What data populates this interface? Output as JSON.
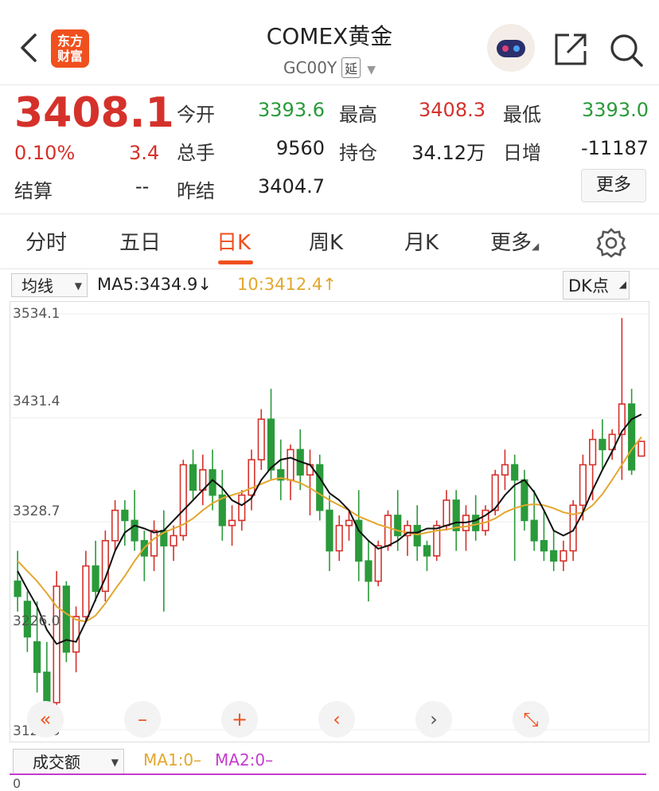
{
  "header": {
    "title": "COMEX黄金",
    "code": "GC00Y",
    "delay_badge": "延",
    "logo_line1": "东方",
    "logo_line2": "财富"
  },
  "quote": {
    "price": "3408.1",
    "change_pct": "0.10%",
    "change": "3.4",
    "settle_label": "结算",
    "settle_value": "--",
    "open_label": "今开",
    "open_value": "3393.6",
    "high_label": "最高",
    "high_value": "3408.3",
    "low_label": "最低",
    "low_value": "3393.0",
    "volume_label": "总手",
    "volume_value": "9560",
    "oi_label": "持仓",
    "oi_value": "34.12万",
    "daily_inc_label": "日增",
    "daily_inc_value": "-11187",
    "prev_settle_label": "昨结",
    "prev_settle_value": "3404.7",
    "more_button": "更多"
  },
  "tabs": [
    "分时",
    "五日",
    "日K",
    "周K",
    "月K",
    "更多"
  ],
  "toolbar": {
    "ma_select": "均线",
    "ma5": "MA5:3434.9",
    "ma10": "10:3412.4",
    "dk": "DK点"
  },
  "chart_data": {
    "type": "candlestick",
    "y_ticks": [
      "3534.1",
      "3431.4",
      "3328.7",
      "3226.0",
      "3123.3"
    ],
    "ylim": [
      3123.3,
      3534.1
    ],
    "up_color": "#d5312b",
    "down_color": "#2a9a3a",
    "ma5_color": "#111111",
    "ma10_color": "#e2a72e",
    "candles": [
      [
        3270,
        3300,
        3240,
        3255
      ],
      [
        3250,
        3260,
        3200,
        3215
      ],
      [
        3210,
        3250,
        3160,
        3180
      ],
      [
        3180,
        3210,
        3140,
        3150
      ],
      [
        3150,
        3280,
        3130,
        3265
      ],
      [
        3265,
        3270,
        3190,
        3200
      ],
      [
        3200,
        3245,
        3180,
        3235
      ],
      [
        3235,
        3300,
        3230,
        3285
      ],
      [
        3285,
        3310,
        3250,
        3260
      ],
      [
        3260,
        3320,
        3250,
        3310
      ],
      [
        3310,
        3350,
        3300,
        3340
      ],
      [
        3340,
        3350,
        3305,
        3330
      ],
      [
        3330,
        3360,
        3300,
        3310
      ],
      [
        3310,
        3320,
        3270,
        3295
      ],
      [
        3295,
        3330,
        3280,
        3320
      ],
      [
        3320,
        3340,
        3240,
        3305
      ],
      [
        3305,
        3325,
        3290,
        3315
      ],
      [
        3315,
        3390,
        3310,
        3385
      ],
      [
        3385,
        3400,
        3350,
        3360
      ],
      [
        3360,
        3395,
        3345,
        3380
      ],
      [
        3380,
        3400,
        3340,
        3355
      ],
      [
        3355,
        3380,
        3310,
        3325
      ],
      [
        3325,
        3345,
        3305,
        3330
      ],
      [
        3330,
        3360,
        3320,
        3355
      ],
      [
        3355,
        3400,
        3340,
        3390
      ],
      [
        3390,
        3440,
        3380,
        3430
      ],
      [
        3430,
        3460,
        3370,
        3380
      ],
      [
        3380,
        3410,
        3350,
        3370
      ],
      [
        3370,
        3405,
        3350,
        3400
      ],
      [
        3400,
        3420,
        3360,
        3375
      ],
      [
        3375,
        3400,
        3335,
        3385
      ],
      [
        3385,
        3395,
        3330,
        3340
      ],
      [
        3340,
        3355,
        3280,
        3300
      ],
      [
        3300,
        3335,
        3290,
        3325
      ],
      [
        3325,
        3340,
        3310,
        3330
      ],
      [
        3330,
        3360,
        3270,
        3290
      ],
      [
        3290,
        3310,
        3250,
        3270
      ],
      [
        3270,
        3310,
        3265,
        3305
      ],
      [
        3305,
        3340,
        3300,
        3335
      ],
      [
        3335,
        3360,
        3300,
        3315
      ],
      [
        3315,
        3330,
        3295,
        3325
      ],
      [
        3325,
        3345,
        3290,
        3305
      ],
      [
        3305,
        3310,
        3280,
        3295
      ],
      [
        3295,
        3330,
        3290,
        3325
      ],
      [
        3325,
        3360,
        3320,
        3350
      ],
      [
        3350,
        3360,
        3300,
        3320
      ],
      [
        3320,
        3345,
        3300,
        3335
      ],
      [
        3335,
        3355,
        3310,
        3320
      ],
      [
        3320,
        3345,
        3315,
        3340
      ],
      [
        3340,
        3380,
        3335,
        3375
      ],
      [
        3375,
        3400,
        3360,
        3385
      ],
      [
        3385,
        3395,
        3290,
        3370
      ],
      [
        3370,
        3380,
        3320,
        3330
      ],
      [
        3330,
        3360,
        3300,
        3310
      ],
      [
        3310,
        3340,
        3290,
        3300
      ],
      [
        3300,
        3320,
        3280,
        3290
      ],
      [
        3290,
        3310,
        3280,
        3300
      ],
      [
        3300,
        3350,
        3290,
        3345
      ],
      [
        3345,
        3395,
        3330,
        3385
      ],
      [
        3385,
        3420,
        3350,
        3410
      ],
      [
        3410,
        3430,
        3380,
        3400
      ],
      [
        3400,
        3420,
        3390,
        3415
      ],
      [
        3415,
        3530,
        3370,
        3445
      ],
      [
        3445,
        3460,
        3375,
        3380
      ],
      [
        3393.6,
        3408.3,
        3393,
        3408.1
      ]
    ],
    "ma5_path": [
      3280,
      3262,
      3245,
      3222,
      3208,
      3212,
      3210,
      3230,
      3252,
      3273,
      3300,
      3318,
      3325,
      3322,
      3318,
      3320,
      3330,
      3340,
      3350,
      3360,
      3370,
      3362,
      3350,
      3345,
      3352,
      3370,
      3382,
      3390,
      3392,
      3388,
      3385,
      3372,
      3357,
      3350,
      3340,
      3320,
      3310,
      3302,
      3305,
      3310,
      3318,
      3318,
      3322,
      3322,
      3325,
      3328,
      3328,
      3330,
      3335,
      3342,
      3355,
      3365,
      3370,
      3358,
      3340,
      3320,
      3315,
      3320,
      3338,
      3360,
      3380,
      3398,
      3418,
      3430,
      3434.9
    ],
    "ma10_path": [
      3290,
      3280,
      3270,
      3258,
      3245,
      3238,
      3232,
      3230,
      3236,
      3248,
      3262,
      3275,
      3290,
      3303,
      3312,
      3318,
      3322,
      3326,
      3332,
      3340,
      3347,
      3352,
      3355,
      3358,
      3362,
      3366,
      3370,
      3372,
      3370,
      3367,
      3362,
      3356,
      3350,
      3345,
      3340,
      3334,
      3330,
      3326,
      3323,
      3320,
      3318,
      3316,
      3318,
      3320,
      3321,
      3323,
      3324,
      3326,
      3328,
      3332,
      3338,
      3342,
      3345,
      3346,
      3345,
      3342,
      3338,
      3336,
      3338,
      3345,
      3356,
      3370,
      3385,
      3400,
      3412.4
    ]
  },
  "controls": [
    "«",
    "–",
    "+",
    "‹",
    "›",
    "⤡"
  ],
  "volume": {
    "select": "成交额",
    "ma1": "MA1:0–",
    "ma2": "MA2:0–",
    "zero": "0"
  },
  "icons": [
    "back-icon",
    "share-icon",
    "search-icon",
    "settings-icon"
  ]
}
